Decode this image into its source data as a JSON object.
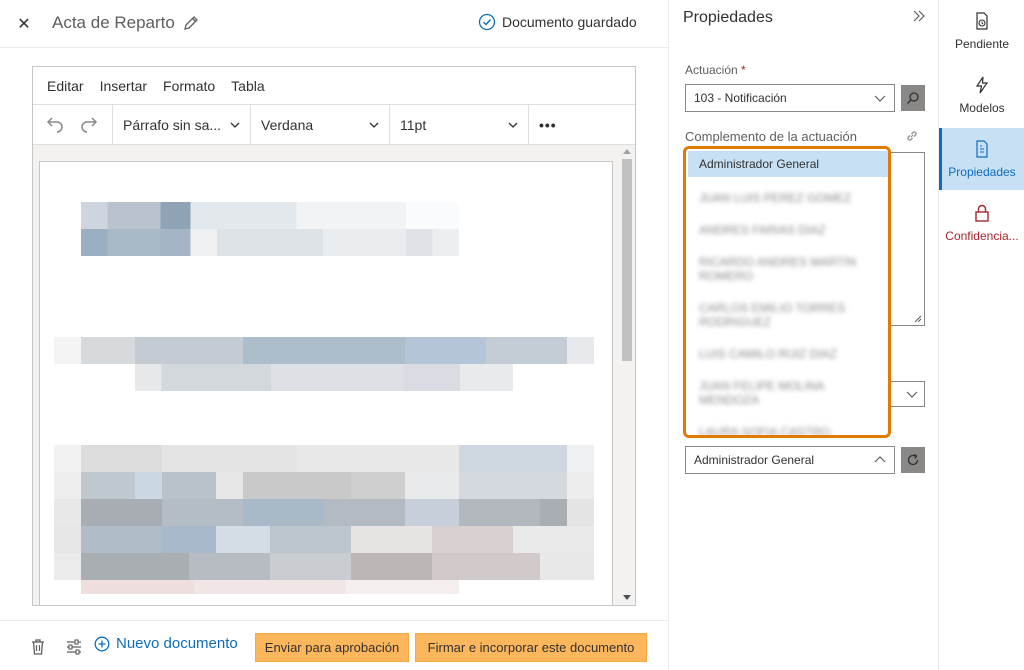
{
  "header": {
    "close_icon": "close-icon",
    "title": "Acta de Reparto",
    "edit_icon": "pencil-icon",
    "saved_status": "Documento guardado",
    "saved_icon": "check-circle-icon"
  },
  "editor": {
    "menu": [
      "Editar",
      "Insertar",
      "Formato",
      "Tabla"
    ],
    "toolbar": {
      "undo_icon": "undo-icon",
      "redo_icon": "redo-icon",
      "paragraph_style": "Párrafo sin sa...",
      "font_family": "Verdana",
      "font_size": "11pt",
      "more_label": "•••"
    }
  },
  "footer": {
    "new_document": "Nuevo documento",
    "send_for_approval": "Enviar para aprobación",
    "sign_and_incorporate": "Firmar e incorporar este documento"
  },
  "properties": {
    "title": "Propiedades",
    "actuacion_label": "Actuación",
    "required_mark": "*",
    "actuacion_value": "103 - Notificación",
    "complemento_label": "Complemento de la actuación",
    "dropdown_options": [
      "Administrador General",
      "JUAN LUIS PEREZ GOMEZ",
      "ANDRES FARIAS DIAZ",
      "RICARDO ANDRES MARTIN ROMERO",
      "CARLOS EMILIO TORRES RODRIGUEZ",
      "LUIS CAMILO RUIZ DIAZ",
      "JUAN FELIPE MOLINA MENDOZA",
      "LAURA SOFIA CASTRO"
    ],
    "assignee_value": "Administrador General"
  },
  "rail": {
    "items": [
      {
        "label": "Pendiente",
        "icon": "pending-document-icon"
      },
      {
        "label": "Modelos",
        "icon": "lightning-icon"
      },
      {
        "label": "Propiedades",
        "icon": "document-properties-icon"
      },
      {
        "label": "Confidencia...",
        "icon": "lock-icon"
      }
    ]
  },
  "colors": {
    "accent": "#0f6cbd",
    "amber_button": "#fcb65c",
    "highlight_border": "#e07b00",
    "selected_item": "#c7e0f4",
    "danger": "#a4262c"
  }
}
